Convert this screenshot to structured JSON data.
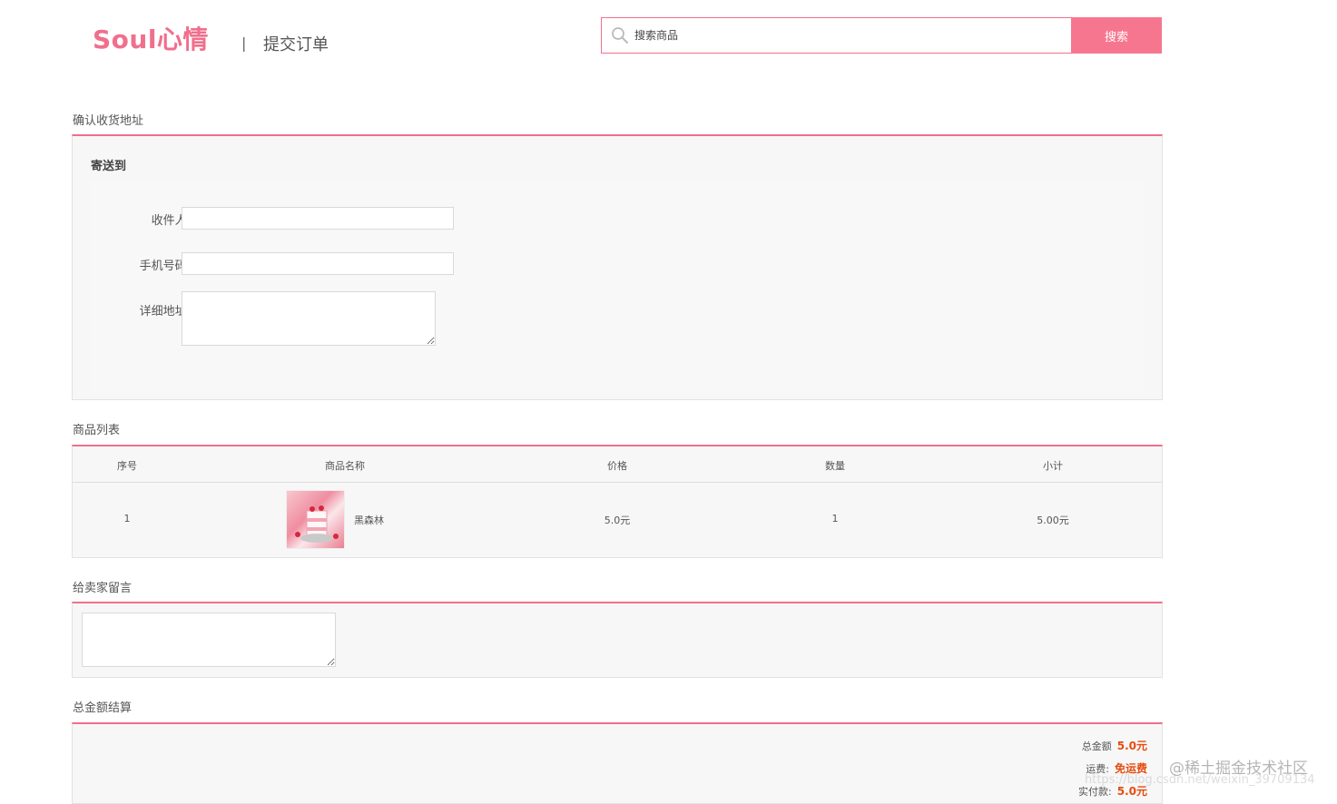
{
  "header": {
    "logo_text": "Soul心情",
    "divider": "|",
    "page_title": "提交订单"
  },
  "search": {
    "placeholder": "搜索商品",
    "button_label": "搜索"
  },
  "address": {
    "section_title": "确认收货地址",
    "ship_to_label": "寄送到",
    "recipient_label": "收件人:",
    "phone_label": "手机号码:",
    "detail_label": "详细地址:",
    "recipient_value": "",
    "phone_value": "",
    "detail_value": ""
  },
  "products": {
    "section_title": "商品列表",
    "columns": [
      "序号",
      "商品名称",
      "价格",
      "数量",
      "小计"
    ],
    "rows": [
      {
        "index": "1",
        "name": "黑森林",
        "price": "5.0元",
        "quantity": "1",
        "subtotal": "5.00元"
      }
    ]
  },
  "message": {
    "section_title": "给卖家留言",
    "value": ""
  },
  "summary": {
    "section_title": "总金额结算",
    "total_label": "总金额",
    "total_value": "5.0元",
    "shipping_label": "运费:",
    "shipping_value": "免运费",
    "paid_label": "实付款:",
    "paid_value": "5.0元"
  },
  "watermark": {
    "text": "@稀土掘金技术社区",
    "url": "https://blog.csdn.net/weixin_39709134"
  },
  "colors": {
    "accent": "#f06f8c",
    "button": "#f7768f",
    "price": "#e64b0f"
  }
}
